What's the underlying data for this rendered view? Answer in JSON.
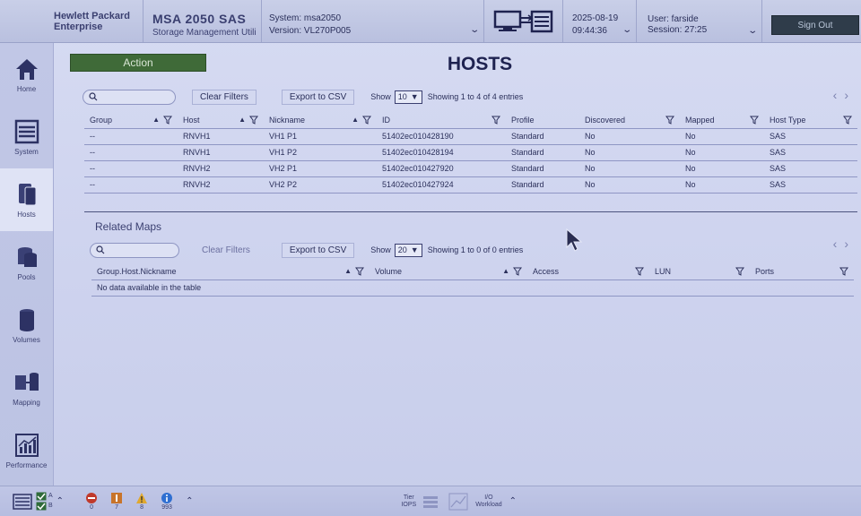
{
  "header": {
    "brand_line1": "Hewlett Packard",
    "brand_line2": "Enterprise",
    "product_name": "MSA 2050 SAS",
    "product_subtitle": "Storage Management Utili",
    "system_label": "System: msa2050",
    "version_label": "Version: VL270P005",
    "date": "2025-08-19",
    "time": "09:44:36",
    "user_label": "User: farside",
    "session_label": "Session: 27:25",
    "sign_out": "Sign Out"
  },
  "sidebar": {
    "items": [
      {
        "label": "Home",
        "icon": "home-icon"
      },
      {
        "label": "System",
        "icon": "system-icon"
      },
      {
        "label": "Hosts",
        "icon": "hosts-icon"
      },
      {
        "label": "Pools",
        "icon": "pools-icon"
      },
      {
        "label": "Volumes",
        "icon": "volumes-icon"
      },
      {
        "label": "Mapping",
        "icon": "mapping-icon"
      },
      {
        "label": "Performance",
        "icon": "performance-icon"
      }
    ],
    "active": "Hosts"
  },
  "main": {
    "action_label": "Action",
    "title": "HOSTS",
    "hosts_toolbar": {
      "search_placeholder": "",
      "clear_filters": "Clear Filters",
      "export_csv": "Export to CSV",
      "show_label": "Show",
      "show_value": "10",
      "entries_text": "Showing 1 to 4 of 4 entries"
    },
    "hosts_table": {
      "columns": [
        "Group",
        "Host",
        "Nickname",
        "ID",
        "Profile",
        "Discovered",
        "Mapped",
        "Host Type"
      ],
      "rows": [
        [
          "--",
          "RNVH1",
          "VH1 P1",
          "51402ec010428190",
          "Standard",
          "No",
          "No",
          "SAS"
        ],
        [
          "--",
          "RNVH1",
          "VH1 P2",
          "51402ec010428194",
          "Standard",
          "No",
          "No",
          "SAS"
        ],
        [
          "--",
          "RNVH2",
          "VH2 P1",
          "51402ec010427920",
          "Standard",
          "No",
          "No",
          "SAS"
        ],
        [
          "--",
          "RNVH2",
          "VH2 P2",
          "51402ec010427924",
          "Standard",
          "No",
          "No",
          "SAS"
        ]
      ]
    },
    "related": {
      "title": "Related Maps",
      "clear_filters": "Clear Filters",
      "export_csv": "Export to CSV",
      "show_label": "Show",
      "show_value": "20",
      "entries_text": "Showing 1 to 0 of 0 entries",
      "columns": [
        "Group.Host.Nickname",
        "Volume",
        "Access",
        "LUN",
        "Ports"
      ],
      "empty_text": "No data available in the table"
    }
  },
  "footer": {
    "controller_a": "A",
    "controller_b": "B",
    "error_count": "0",
    "critical_count": "7",
    "warning_count": "8",
    "info_count": "993",
    "tier_label": "Tier",
    "iops_label": "IOPS",
    "io_label": "I/O",
    "workload_label": "Workload"
  },
  "colors": {
    "accent_green": "#3f6a38",
    "signout_bg": "#2f3c4a",
    "error": "#c0392b",
    "warning": "#e0a82e",
    "info": "#2f6fd1"
  }
}
